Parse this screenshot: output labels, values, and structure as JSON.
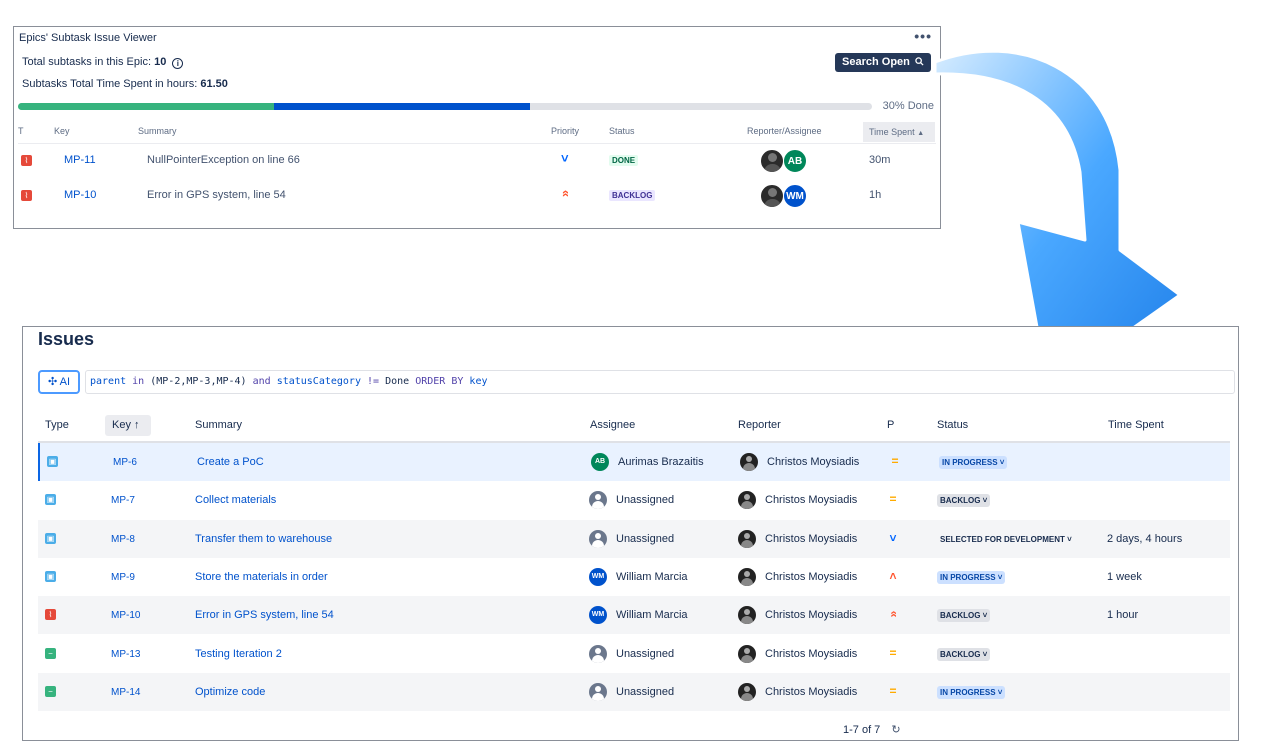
{
  "panel": {
    "title": "Epics' Subtask Issue Viewer",
    "more": "•••",
    "total_subtasks_label": "Total subtasks in this Epic:",
    "total_subtasks_value": "10",
    "time_spent_label": "Subtasks Total Time Spent in hours:",
    "time_spent_value": "61.50",
    "search_button": "Search Open",
    "progress_done_fraction": 0.3,
    "progress_in_progress_fraction": 0.3,
    "progress_label": "30% Done",
    "columns": {
      "type": "T",
      "key": "Key",
      "summary": "Summary",
      "priority": "Priority",
      "status": "Status",
      "reporter_assignee": "Reporter/Assignee",
      "time_spent": "Time Spent"
    },
    "rows": [
      {
        "key": "MP-11",
        "summary": "NullPointerException on line 66",
        "priority": "low",
        "status": "DONE",
        "assignee_initials": "AB",
        "assignee_color": "#00875a",
        "time_spent": "30m"
      },
      {
        "key": "MP-10",
        "summary": "Error in GPS system, line 54",
        "priority": "highest",
        "status": "BACKLOG",
        "assignee_initials": "WM",
        "assignee_color": "#0052cc",
        "time_spent": "1h"
      }
    ]
  },
  "issues": {
    "heading": "Issues",
    "ai_label": "AI",
    "jql": {
      "field1": "parent",
      "op1": "in",
      "values": "(MP-2,MP-3,MP-4)",
      "and": "and",
      "field2": "statusCategory",
      "op2": "!=",
      "value2": "Done",
      "order": "ORDER BY",
      "order_field": "key"
    },
    "columns": {
      "type": "Type",
      "key": "Key",
      "summary": "Summary",
      "assignee": "Assignee",
      "reporter": "Reporter",
      "priority": "P",
      "status": "Status",
      "time_spent": "Time Spent"
    },
    "rows": [
      {
        "type": "subtask",
        "key": "MP-6",
        "summary": "Create a PoC",
        "assignee": "Aurimas Brazaitis",
        "assignee_initials": "AB",
        "assignee_color": "#00875a",
        "reporter": "Christos Moysiadis",
        "priority": "medium",
        "status": "IN PROGRESS",
        "time_spent": ""
      },
      {
        "type": "subtask",
        "key": "MP-7",
        "summary": "Collect materials",
        "assignee": "Unassigned",
        "assignee_initials": "",
        "assignee_color": "",
        "reporter": "Christos Moysiadis",
        "priority": "medium",
        "status": "BACKLOG",
        "time_spent": ""
      },
      {
        "type": "subtask",
        "key": "MP-8",
        "summary": "Transfer them to warehouse",
        "assignee": "Unassigned",
        "assignee_initials": "",
        "assignee_color": "",
        "reporter": "Christos Moysiadis",
        "priority": "low",
        "status": "SELECTED FOR DEVELOPMENT",
        "time_spent": "2 days, 4 hours"
      },
      {
        "type": "subtask",
        "key": "MP-9",
        "summary": "Store the materials in order",
        "assignee": "William Marcia",
        "assignee_initials": "WM",
        "assignee_color": "#0052cc",
        "reporter": "Christos Moysiadis",
        "priority": "high",
        "status": "IN PROGRESS",
        "time_spent": "1 week"
      },
      {
        "type": "bug",
        "key": "MP-10",
        "summary": "Error in GPS system, line 54",
        "assignee": "William Marcia",
        "assignee_initials": "WM",
        "assignee_color": "#0052cc",
        "reporter": "Christos Moysiadis",
        "priority": "highest",
        "status": "BACKLOG",
        "time_spent": "1 hour"
      },
      {
        "type": "task",
        "key": "MP-13",
        "summary": "Testing Iteration 2",
        "assignee": "Unassigned",
        "assignee_initials": "",
        "assignee_color": "",
        "reporter": "Christos Moysiadis",
        "priority": "medium",
        "status": "BACKLOG",
        "time_spent": ""
      },
      {
        "type": "task",
        "key": "MP-14",
        "summary": "Optimize code",
        "assignee": "Unassigned",
        "assignee_initials": "",
        "assignee_color": "",
        "reporter": "Christos Moysiadis",
        "priority": "medium",
        "status": "IN PROGRESS",
        "time_spent": ""
      }
    ],
    "pagination": "1-7 of 7"
  },
  "colors": {
    "progress_done": "#36b37e",
    "progress_in_progress": "#0052cc",
    "arrow": "#4aa8ff",
    "priority_medium": "#ffab00",
    "priority_low": "#0065ff",
    "priority_high": "#ff5630"
  }
}
